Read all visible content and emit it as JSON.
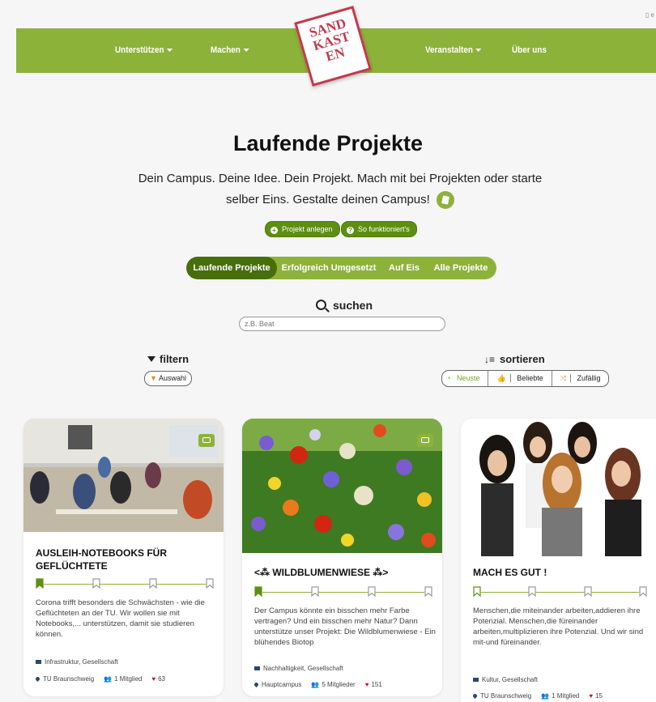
{
  "nav": {
    "left": [
      "Unterstützen",
      "Machen"
    ],
    "right": [
      "Veranstalten",
      "Über uns"
    ],
    "logo_text": "SAND\nKAST\nEN"
  },
  "hero": {
    "title": "Laufende Projekte",
    "subtitle": "Dein Campus. Deine Idee. Dein Projekt. Mach mit bei Projekten oder starte selber Eins. Gestalte deinen Campus!",
    "btn_create": "Projekt anlegen",
    "btn_howto": "So funktioniert's"
  },
  "tabs": [
    "Laufende Projekte",
    "Erfolgreich Umgesetzt",
    "Auf Eis",
    "Alle Projekte"
  ],
  "search": {
    "label": "suchen",
    "placeholder": "z.B. Beat"
  },
  "filter": {
    "label": "filtern",
    "chip": "Auswahl"
  },
  "sort": {
    "label": "sortieren",
    "options": [
      "Neuste",
      "Beliebte",
      "Zufällig"
    ]
  },
  "cards": [
    {
      "title": "AUSLEIH-NOTEBOOKS FÜR GEFLÜCHTETE",
      "progress_filled": 1,
      "description": "Corona trifft besonders die Schwächsten - wie die Geflüchteten an der TU. Wir wollen sie mit Notebooks,... unterstützen, damit sie studieren können.",
      "tags": "Infrastruktur, Gesellschaft",
      "location": "TU Braunschweig",
      "members": "1 Mitglied",
      "likes": "63"
    },
    {
      "title": "<⁂ WILDBLUMENWIESE ⁂>",
      "progress_filled": 1,
      "description": "Der Campus könnte ein bisschen mehr Farbe vertragen? Und ein bisschen mehr Natur? Dann unterstütze unser Projekt: Die Wildblumenwiese - Ein blühendes Biotop",
      "tags": "Nachhaltigkeit, Gesellschaft",
      "location": "Hauptcampus",
      "members": "5 Mitglieder",
      "likes": "151"
    },
    {
      "title": "MACH ES GUT !",
      "progress_filled": 0,
      "description": "Menschen,die miteinander arbeiten,addieren ihre Potenzial. Menschen,die füreinander arbeiten,multiplizieren ihre Potenzial. Und wir sind mit-und füreinander.",
      "tags": "Kultur, Gesellschaft",
      "location": "TU Braunschweig",
      "members": "1 Mitglied",
      "likes": "15"
    }
  ],
  "colors": {
    "brand": "#8db23a",
    "dark": "#476e0b",
    "logo": "#c33a4c",
    "heart": "#c0182a"
  }
}
